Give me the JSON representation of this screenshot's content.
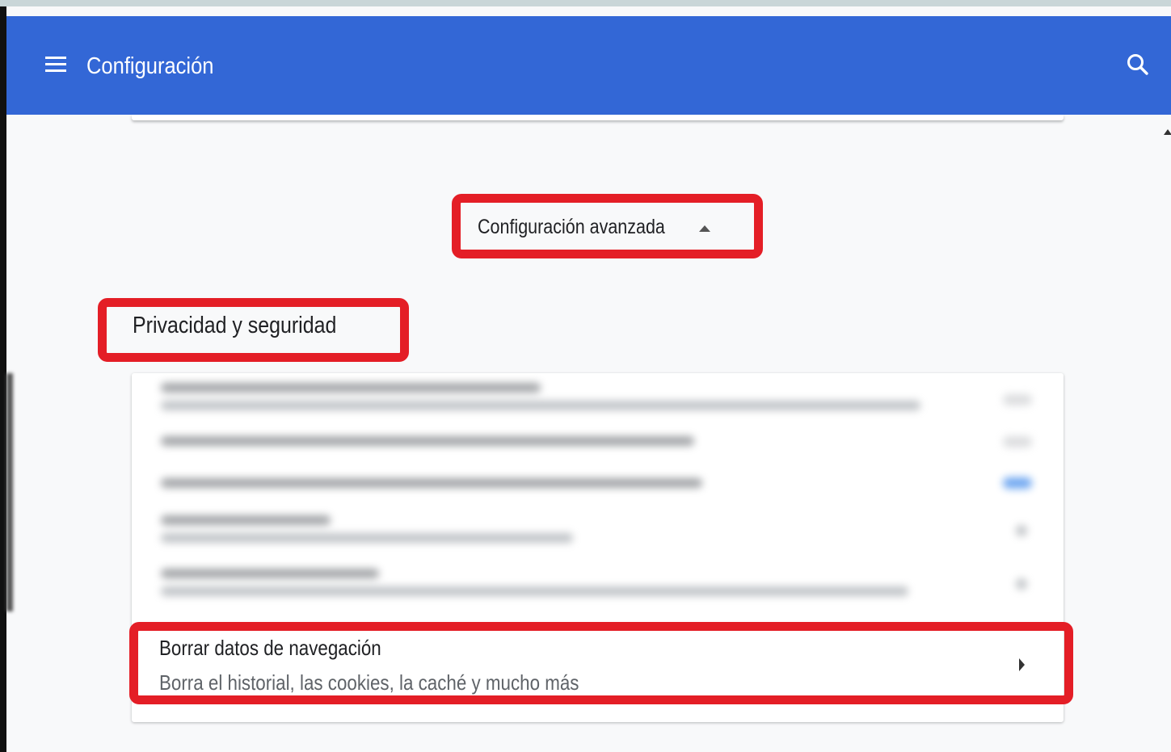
{
  "header": {
    "title": "Configuración",
    "background_color": "#3367d6",
    "menu_icon": "hamburger-menu-icon",
    "search_icon": "search-icon"
  },
  "advanced": {
    "label": "Configuración avanzada",
    "icon": "caret-up-icon"
  },
  "section": {
    "title": "Privacidad y seguridad"
  },
  "clear_data_row": {
    "title": "Borrar datos de navegación",
    "subtitle": "Borra el historial, las cookies, la caché y mucho más",
    "icon": "chevron-right-icon"
  },
  "highlight_color": "#e41e26"
}
